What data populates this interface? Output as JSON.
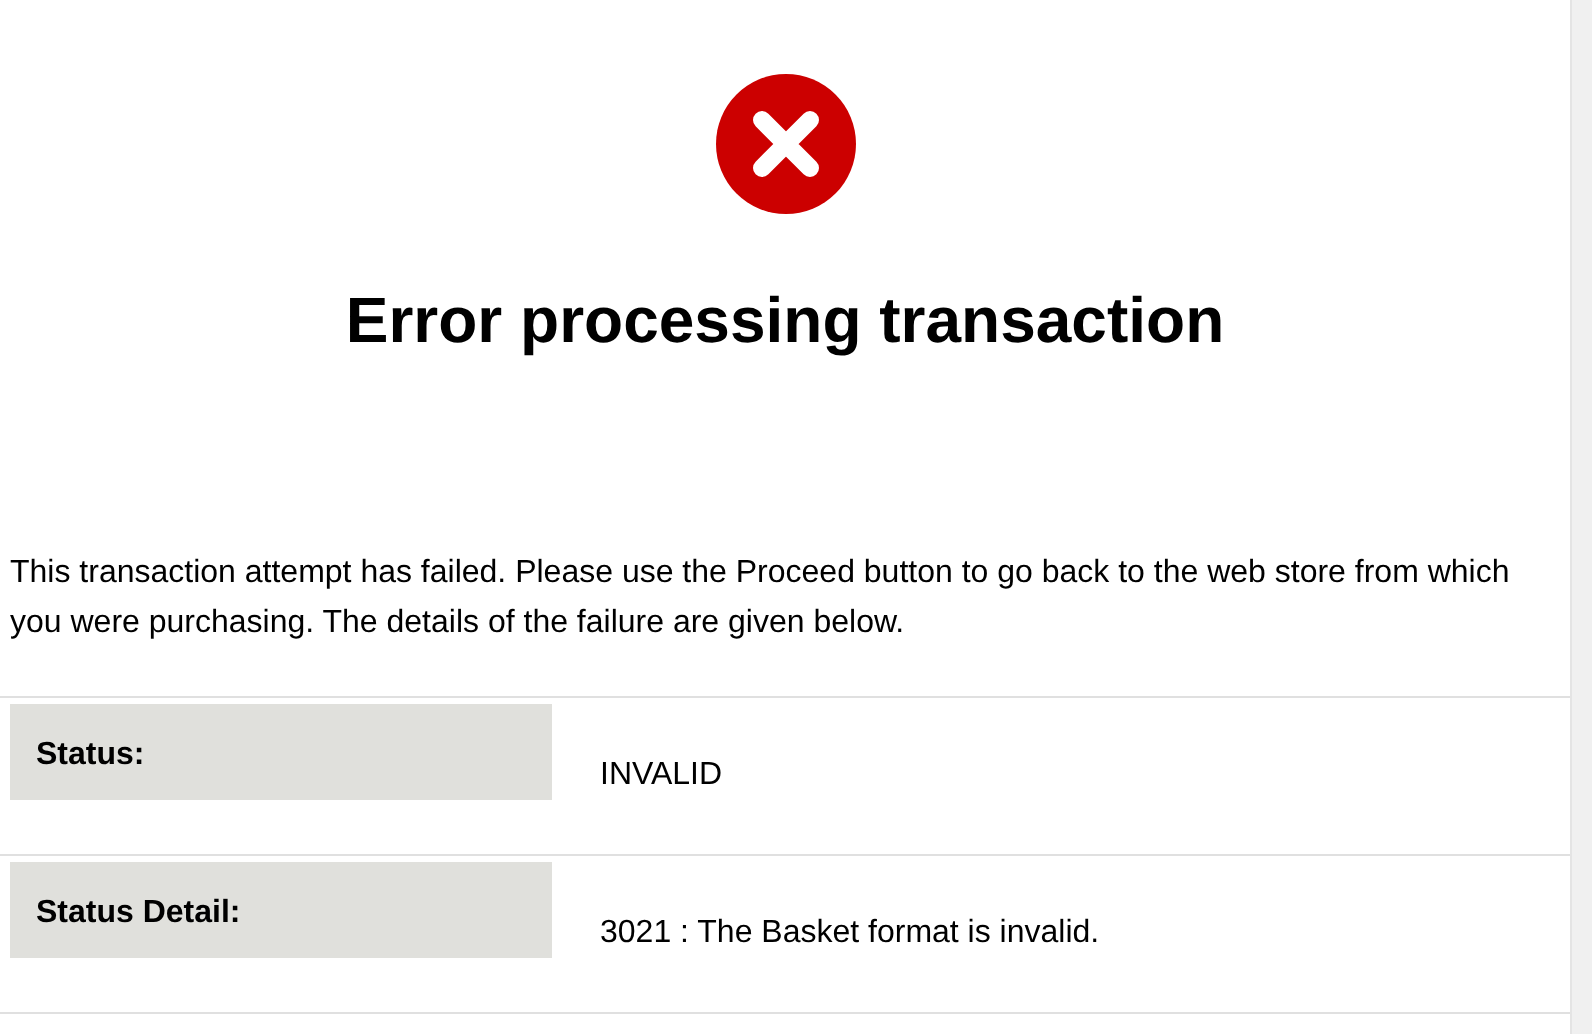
{
  "title": "Error processing transaction",
  "message": "This transaction attempt has failed. Please use the Proceed button to go back to the web store from which you were purchasing. The details of the failure are given below.",
  "details": [
    {
      "label": "Status:",
      "value": "INVALID"
    },
    {
      "label": "Status Detail:",
      "value": "3021 : The Basket format is invalid."
    }
  ]
}
